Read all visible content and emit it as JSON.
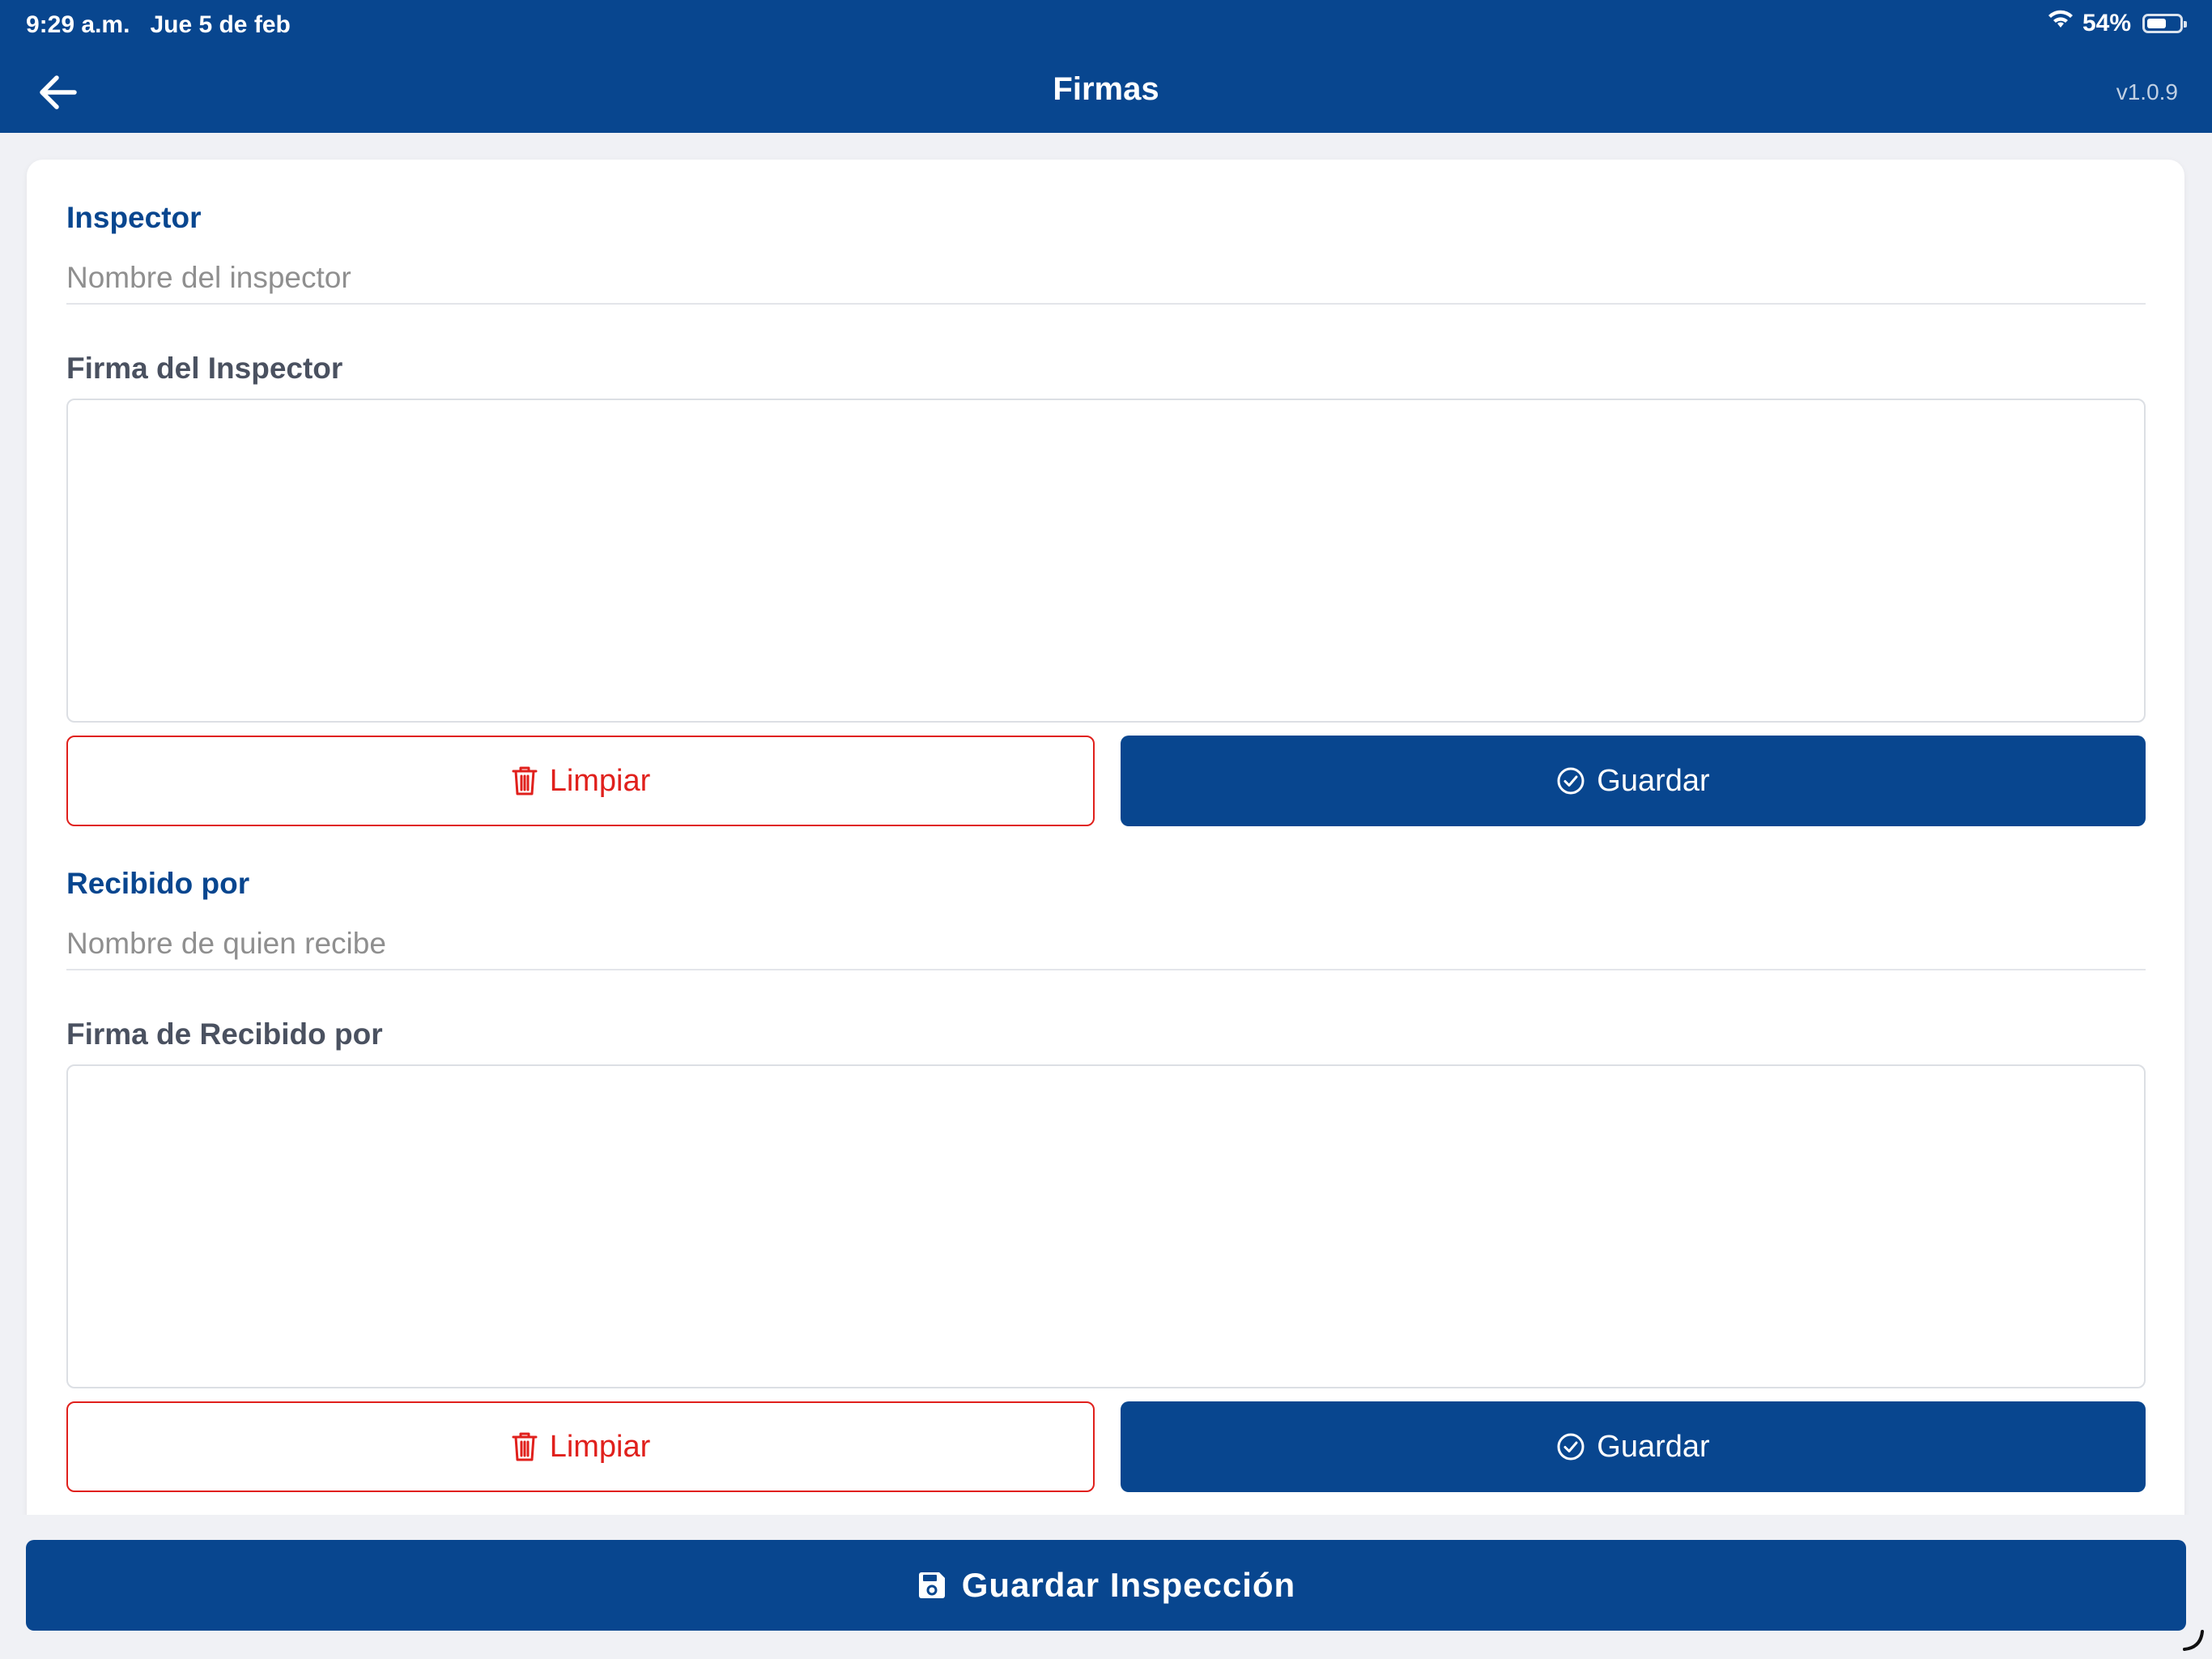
{
  "status_bar": {
    "time": "9:29 a.m.",
    "date": "Jue 5 de feb",
    "battery_percent": "54%",
    "battery_level": 0.54
  },
  "header": {
    "title": "Firmas",
    "version": "v1.0.9"
  },
  "inspector": {
    "section_label": "Inspector",
    "name_placeholder": "Nombre del inspector",
    "name_value": "",
    "signature_label": "Firma del Inspector",
    "clear_label": "Limpiar",
    "save_label": "Guardar"
  },
  "receiver": {
    "section_label": "Recibido por",
    "name_placeholder": "Nombre de quien recibe",
    "name_value": "",
    "signature_label": "Firma de Recibido por",
    "clear_label": "Limpiar",
    "save_label": "Guardar"
  },
  "footer": {
    "save_inspection_label": "Guardar Inspección"
  },
  "colors": {
    "primary": "#08468f",
    "danger": "#e0201c",
    "label_dark": "#4a5160",
    "background": "#f0f1f5"
  },
  "icons": {
    "back": "arrow-left-icon",
    "clear": "trash-icon",
    "save": "check-circle-icon",
    "save_inspection": "floppy-disk-icon",
    "wifi": "wifi-icon",
    "battery": "battery-icon"
  }
}
